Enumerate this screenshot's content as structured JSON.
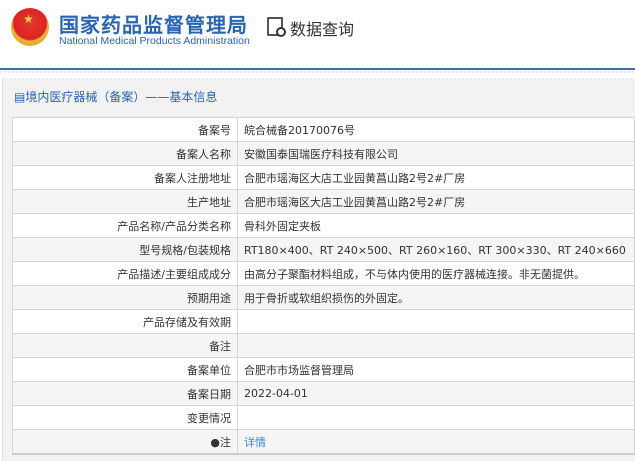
{
  "header": {
    "brand_cn": "国家药品监督管理局",
    "brand_en": "National Medical Products Administration",
    "query_title": "数据查询"
  },
  "panel": {
    "title": "境内医疗器械（备案）——基本信息"
  },
  "rows": [
    {
      "label": "备案号",
      "value": "皖合械备20170076号"
    },
    {
      "label": "备案人名称",
      "value": "安徽国泰国瑞医疗科技有限公司"
    },
    {
      "label": "备案人注册地址",
      "value": "合肥市瑶海区大店工业园黄菖山路2号2#厂房"
    },
    {
      "label": "生产地址",
      "value": "合肥市瑶海区大店工业园黄菖山路2号2#厂房"
    },
    {
      "label": "产品名称/产品分类名称",
      "value": "骨科外固定夹板"
    },
    {
      "label": "型号规格/包装规格",
      "value": "RT180×400、RT 240×500、RT 260×160、RT 300×330、RT 240×660"
    },
    {
      "label": "产品描述/主要组成成分",
      "value": "由高分子聚酯材料组成，不与体内使用的医疗器械连接。非无菌提供。"
    },
    {
      "label": "预期用途",
      "value": "用于骨折或软组织损伤的外固定。"
    },
    {
      "label": "产品存储及有效期",
      "value": ""
    },
    {
      "label": "备注",
      "value": ""
    },
    {
      "label": "备案单位",
      "value": "合肥市市场监督管理局"
    },
    {
      "label": "备案日期",
      "value": "2022-04-01"
    },
    {
      "label": "变更情况",
      "value": ""
    },
    {
      "label": "注",
      "value": "详情"
    }
  ]
}
